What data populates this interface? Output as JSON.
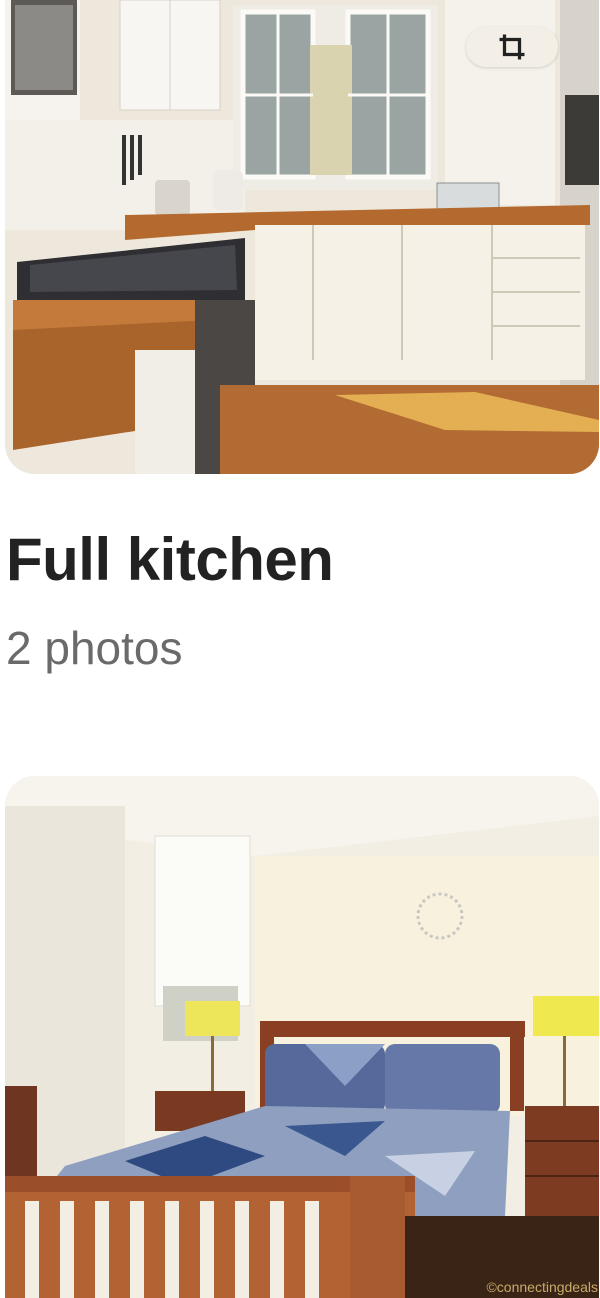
{
  "gallery": {
    "section": {
      "title": "Full kitchen",
      "photo_count_label": "2 photos"
    },
    "crop_button": {
      "icon": "crop-icon"
    },
    "photos": [
      {
        "subject": "kitchen"
      },
      {
        "subject": "bedroom"
      }
    ]
  },
  "watermark": "©connectingdeals",
  "colors": {
    "text_primary": "#222222",
    "text_secondary": "#6a6a6a",
    "background": "#ffffff"
  }
}
